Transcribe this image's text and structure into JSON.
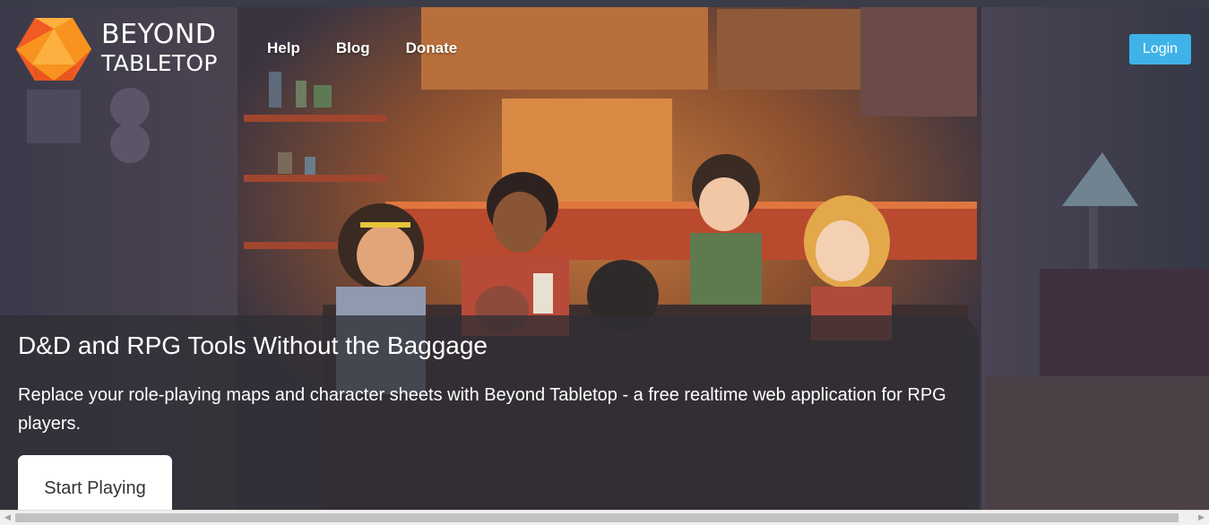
{
  "brand": {
    "line1": "BEYOND",
    "line2": "TABLETOP",
    "logo_icon": "orange-d20-icon",
    "logo_color": "#f7931e"
  },
  "nav": {
    "items": [
      {
        "label": "Help"
      },
      {
        "label": "Blog"
      },
      {
        "label": "Donate"
      }
    ]
  },
  "login": {
    "label": "Login",
    "color": "#3fb2e8"
  },
  "hero": {
    "title": "D&D and RPG Tools Without the Baggage",
    "subtitle": "Replace your role-playing maps and character sheets with Beyond Tabletop - a free realtime web application for RPG players.",
    "cta_label": "Start Playing",
    "background": "pixel-art-friends-gaming-at-table"
  },
  "scrollbar": {
    "left_icon": "arrow-left-icon",
    "right_icon": "arrow-right-icon"
  }
}
